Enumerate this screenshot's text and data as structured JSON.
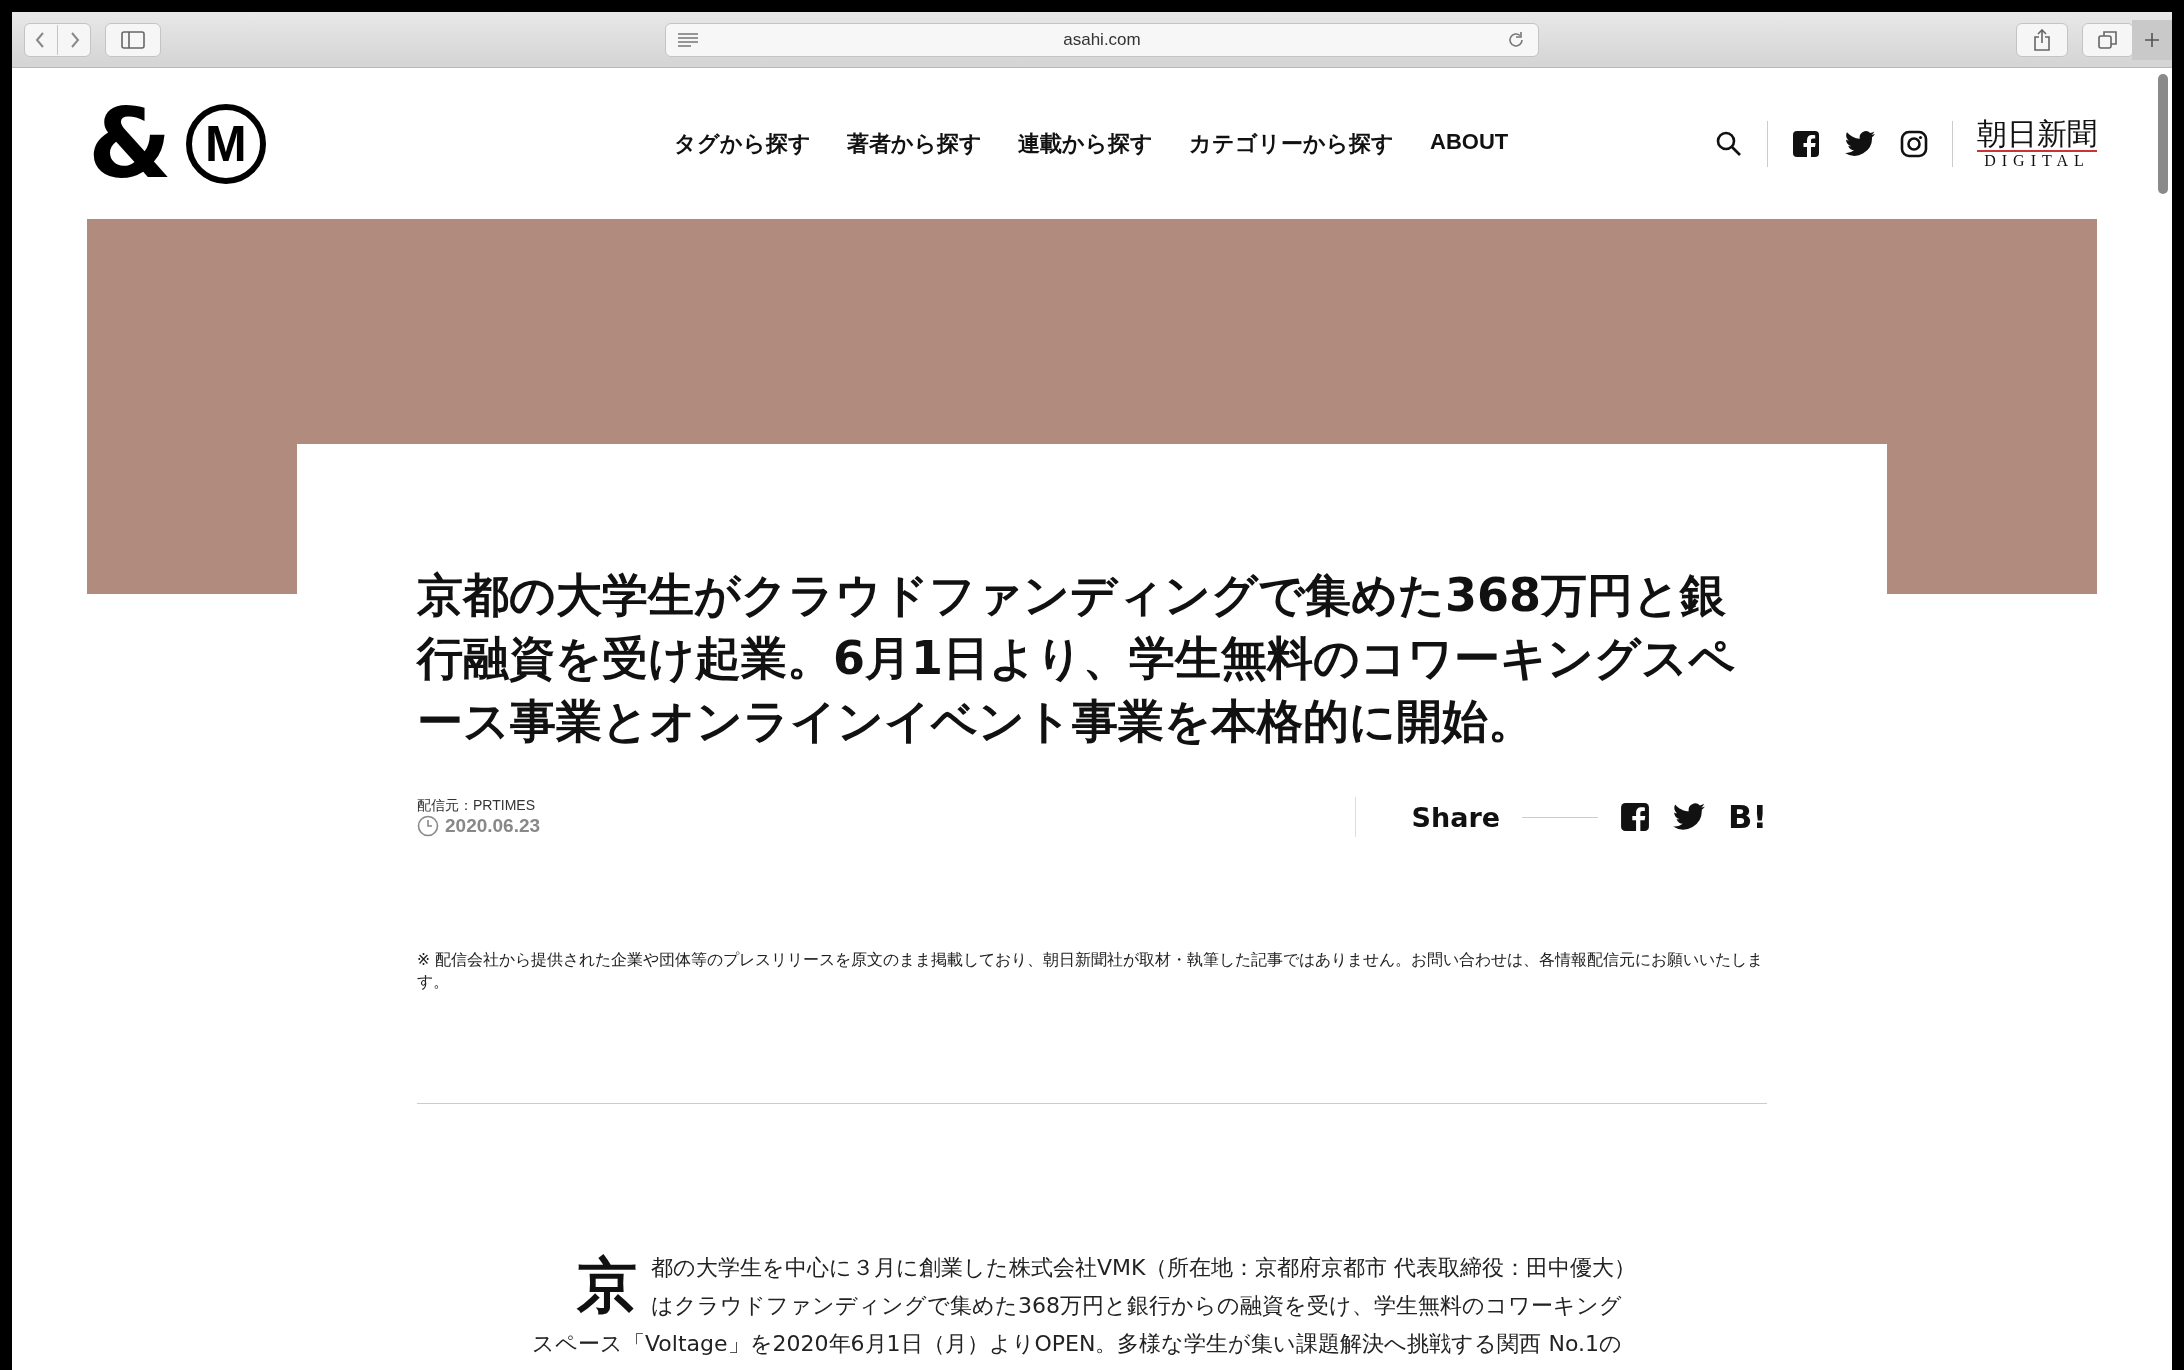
{
  "browser": {
    "url": "asahi.com"
  },
  "header": {
    "logo": {
      "ampersand": "&",
      "letter": "M"
    },
    "nav": [
      "タグから探す",
      "著者から探す",
      "連載から探す",
      "カテゴリーから探す",
      "ABOUT"
    ],
    "brand": {
      "name": "朝日新聞",
      "sub": "DIGITAL"
    }
  },
  "article": {
    "title": "京都の大学生がクラウドファンディングで集めた368万円と銀行融資を受け起業。6月1日より、学生無料のコワーキングスペース事業とオンラインイベント事業を本格的に開始。",
    "source": "配信元：PRTIMES",
    "date": "2020.06.23",
    "share_label": "Share",
    "hatena": "B!",
    "disclaimer": "※ 配信会社から提供された企業や団体等のプレスリリースを原文のまま掲載しており、朝日新聞社が取材・執筆した記事ではありません。お問い合わせは、各情報配信元にお願いいたします。",
    "drop_cap": "京",
    "body": "都の大学生を中心に３月に創業した株式会社VMK（所在地：京都府京都市 代表取締役：田中優大）はクラウドファンディングで集めた368万円と銀行からの融資を受け、学生無料のコワーキングスペース「Voltage」を2020年6月1日（月）よりOPEN。多様な学生が集い課題解決へ挑戦する関西 No.1の"
  }
}
